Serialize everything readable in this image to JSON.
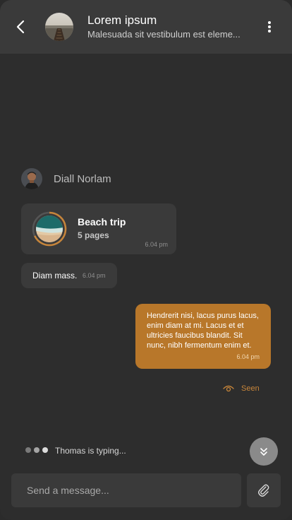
{
  "colors": {
    "background": "#2d2d2d",
    "surface": "#3a3a3a",
    "accent": "#b8772a",
    "seen": "#c7853a",
    "muted_text": "#8f8f8f"
  },
  "header": {
    "title": "Lorem ipsum",
    "subtitle": "Malesuada sit vestibulum est eleme...",
    "back_icon": "chevron-left-icon",
    "menu_icon": "more-vertical-icon"
  },
  "messages": {
    "incoming": {
      "sender": "Diall Norlam",
      "file": {
        "title": "Beach trip",
        "pages": "5 pages",
        "time": "6.04 pm"
      },
      "text": "Diam mass.",
      "text_time": "6.04 pm"
    },
    "outgoing": {
      "text": "Hendrerit nisi, lacus purus lacus, enim diam at mi. Lacus et et ultricies faucibus blandit. Sit nunc, nibh fermentum enim et.",
      "time": "6.04 pm",
      "seen_label": "Seen",
      "seen_icon": "eye-icon"
    }
  },
  "typing": {
    "text": "Thomas is typing..."
  },
  "scroll_down_icon": "chevrons-down-icon",
  "composer": {
    "placeholder": "Send a message...",
    "value": "",
    "attach_icon": "paperclip-icon"
  }
}
